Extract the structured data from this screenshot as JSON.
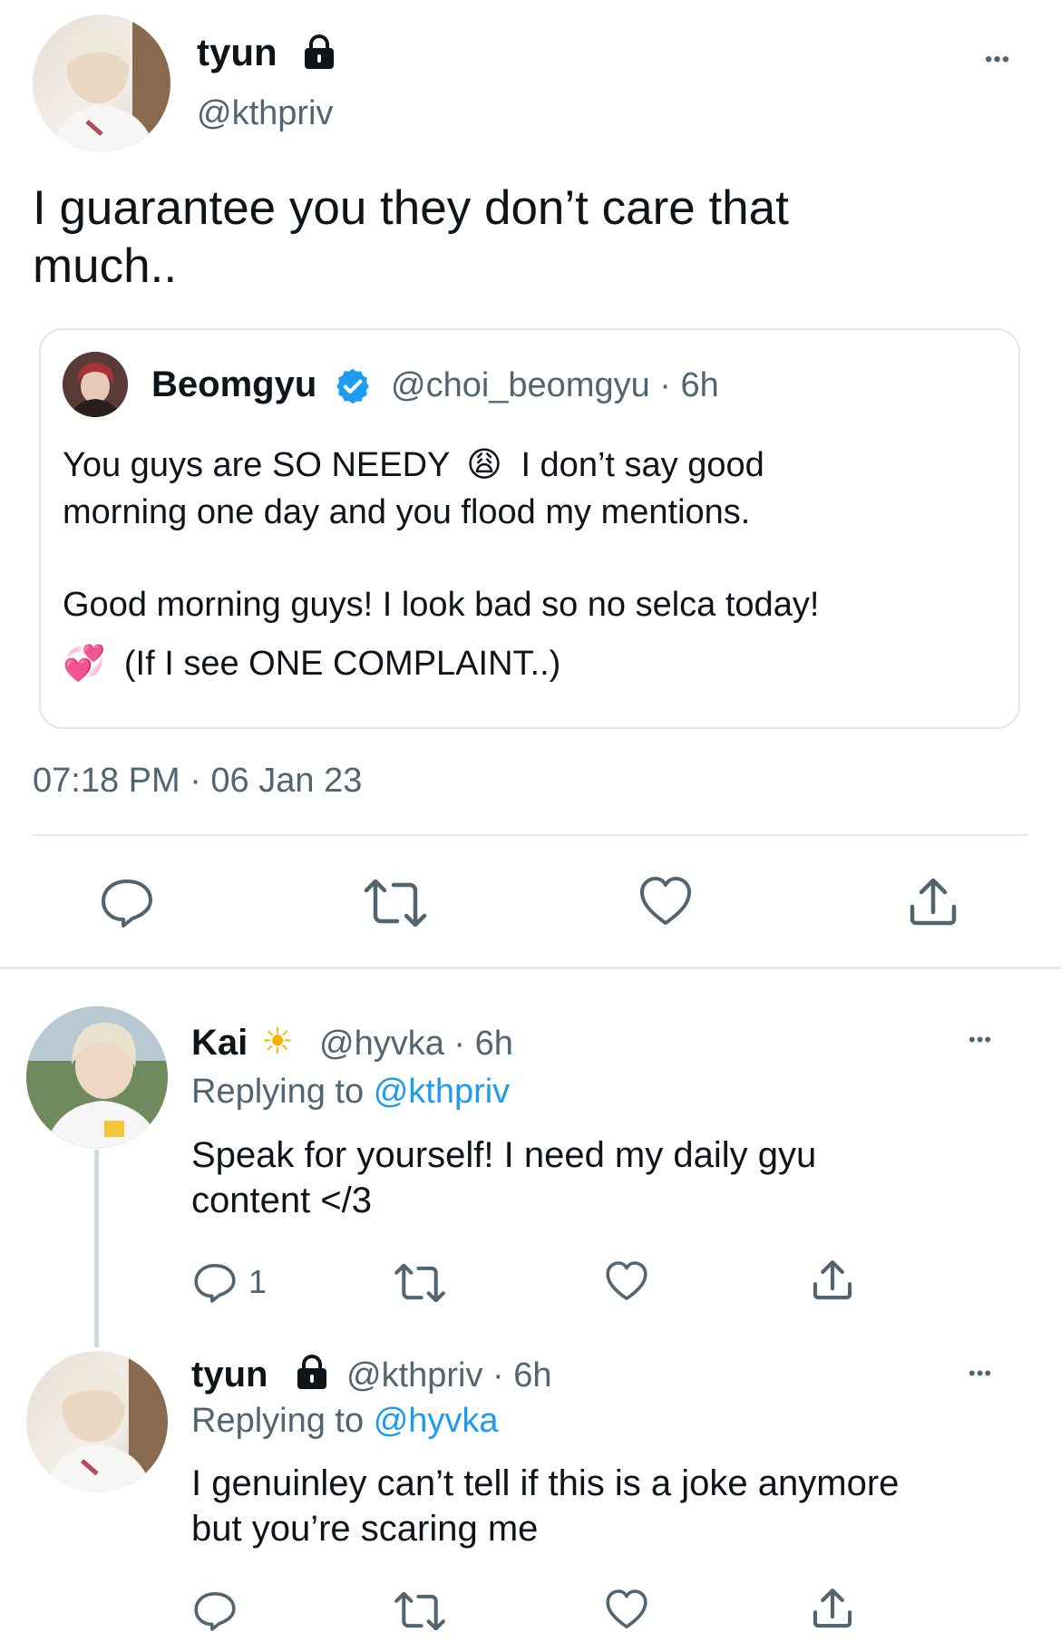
{
  "main_tweet": {
    "display_name": "tyun",
    "handle": "@kthpriv",
    "text_line1": "I guarantee you they don’t care that",
    "text_line2": "much..",
    "timestamp": "07:18 PM · 06 Jan 23",
    "more_label": "•••"
  },
  "quoted_tweet": {
    "display_name": "Beomgyu",
    "handle_time": "@choi_beomgyu · 6h",
    "line1_part1": "You guys are SO NEEDY",
    "line1_emoji": "😩",
    "line1_part2": "I don’t say good",
    "line2": "morning one day and you flood my mentions.",
    "line3": "Good morning guys! I look bad so no selca today!",
    "line4_emoji": "💞",
    "line4_text": "(If I see ONE COMPLAINT..)"
  },
  "reply1": {
    "display_name": "Kai",
    "name_emoji": "☀",
    "handle_time": "@hyvka · 6h",
    "replying_prefix": "Replying to",
    "replying_handle": "@kthpriv",
    "text_line1": "Speak for yourself! I need my daily gyu",
    "text_line2": "content </3",
    "reply_count": "1",
    "more_label": "•••"
  },
  "reply2": {
    "display_name": "tyun",
    "handle_time": "@kthpriv · 6h",
    "replying_prefix": "Replying to",
    "replying_handle": "@hyvka",
    "text_line1": "I genuinley can’t tell if this is a joke anymore",
    "text_line2": "but you’re scaring me",
    "more_label": "•••"
  },
  "colors": {
    "text": "#0f1419",
    "secondary": "#536471",
    "link": "#1d9bf0",
    "verified": "#1d9bf0",
    "divider": "#e4e8eb"
  }
}
